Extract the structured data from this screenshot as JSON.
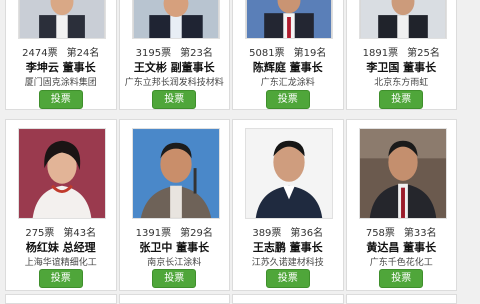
{
  "vote_button_label": "投票",
  "colors": {
    "button": "#4fa63a",
    "card_border": "#dcdcdc",
    "background": "#f0f0f0"
  },
  "row1": [
    {
      "votes": "2474票",
      "rank": "第24名",
      "name": "李坤云 董事长",
      "company": "厦门固克涂料集团"
    },
    {
      "votes": "3195票",
      "rank": "第23名",
      "name": "王文彬 副董事长",
      "company": "广东立邦长润发科技材料"
    },
    {
      "votes": "5081票",
      "rank": "第19名",
      "name": "陈辉庭 董事长",
      "company": "广东汇龙涂料"
    },
    {
      "votes": "1891票",
      "rank": "第25名",
      "name": "李卫国 董事长",
      "company": "北京东方雨虹"
    }
  ],
  "row2": [
    {
      "votes": "275票",
      "rank": "第43名",
      "name": "杨红妹 总经理",
      "company": "上海华谊精细化工"
    },
    {
      "votes": "1391票",
      "rank": "第29名",
      "name": "张卫中 董事长",
      "company": "南京长江涂料"
    },
    {
      "votes": "389票",
      "rank": "第36名",
      "name": "王志鹏 董事长",
      "company": "江苏久诺建材科技"
    },
    {
      "votes": "758票",
      "rank": "第33名",
      "name": "黄达昌 董事长",
      "company": "广东千色花化工"
    }
  ]
}
